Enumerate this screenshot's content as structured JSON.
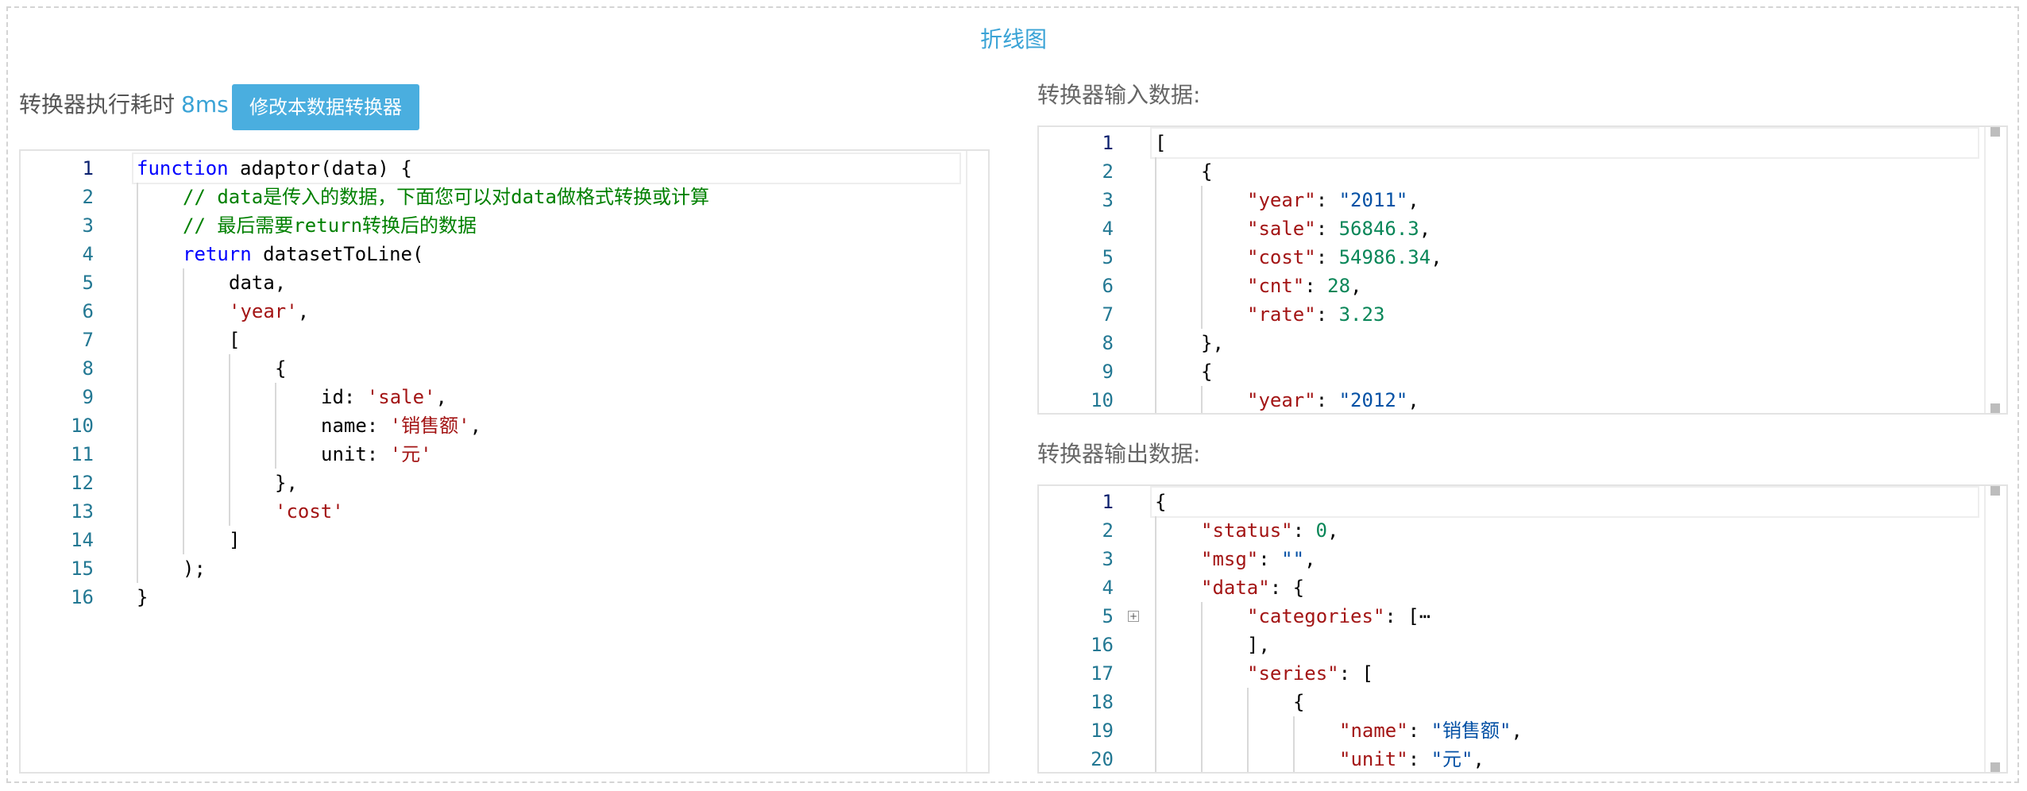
{
  "page": {
    "title": "折线图"
  },
  "perf": {
    "label": "转换器执行耗时",
    "value": "8ms"
  },
  "toolbar": {
    "edit_label": "修改本数据转换器"
  },
  "input_label": "转换器输入数据:",
  "output_label": "转换器输出数据:",
  "colors": {
    "accent": "#3aa3d6",
    "button": "#4aaedf",
    "keyword": "#0000ff",
    "comment": "#008000",
    "string": "#a31515",
    "json_value": "#0451a5",
    "json_number": "#098658",
    "line_number": "#237893"
  },
  "adaptor_code": [
    {
      "n": "1",
      "indent": 0,
      "tokens": [
        {
          "t": "function",
          "c": "kw"
        },
        {
          "t": " adaptor(data) {"
        }
      ]
    },
    {
      "n": "2",
      "indent": 1,
      "tokens": [
        {
          "t": "// data是传入的数据，下面您可以对data做格式转换或计算",
          "c": "cm"
        }
      ]
    },
    {
      "n": "3",
      "indent": 1,
      "tokens": [
        {
          "t": "// 最后需要return转换后的数据",
          "c": "cm"
        }
      ]
    },
    {
      "n": "4",
      "indent": 1,
      "tokens": [
        {
          "t": "return",
          "c": "kw"
        },
        {
          "t": " datasetToLine("
        }
      ]
    },
    {
      "n": "5",
      "indent": 2,
      "tokens": [
        {
          "t": "data,"
        }
      ]
    },
    {
      "n": "6",
      "indent": 2,
      "tokens": [
        {
          "t": "'year'",
          "c": "st"
        },
        {
          "t": ","
        }
      ]
    },
    {
      "n": "7",
      "indent": 2,
      "tokens": [
        {
          "t": "["
        }
      ]
    },
    {
      "n": "8",
      "indent": 3,
      "tokens": [
        {
          "t": "{"
        }
      ]
    },
    {
      "n": "9",
      "indent": 4,
      "tokens": [
        {
          "t": "id: "
        },
        {
          "t": "'sale'",
          "c": "st"
        },
        {
          "t": ","
        }
      ]
    },
    {
      "n": "10",
      "indent": 4,
      "tokens": [
        {
          "t": "name: "
        },
        {
          "t": "'销售额'",
          "c": "st"
        },
        {
          "t": ","
        }
      ]
    },
    {
      "n": "11",
      "indent": 4,
      "tokens": [
        {
          "t": "unit: "
        },
        {
          "t": "'元'",
          "c": "st"
        }
      ]
    },
    {
      "n": "12",
      "indent": 3,
      "tokens": [
        {
          "t": "},"
        }
      ]
    },
    {
      "n": "13",
      "indent": 3,
      "tokens": [
        {
          "t": "'cost'",
          "c": "st"
        }
      ]
    },
    {
      "n": "14",
      "indent": 2,
      "tokens": [
        {
          "t": "]"
        }
      ]
    },
    {
      "n": "15",
      "indent": 1,
      "tokens": [
        {
          "t": ");"
        }
      ]
    },
    {
      "n": "16",
      "indent": 0,
      "tokens": [
        {
          "t": "}"
        }
      ]
    }
  ],
  "input_json": [
    {
      "n": "1",
      "indent": 0,
      "tokens": [
        {
          "t": "["
        }
      ]
    },
    {
      "n": "2",
      "indent": 1,
      "tokens": [
        {
          "t": "{"
        }
      ]
    },
    {
      "n": "3",
      "indent": 2,
      "tokens": [
        {
          "t": "\"year\"",
          "c": "jk"
        },
        {
          "t": ": "
        },
        {
          "t": "\"2011\"",
          "c": "jv"
        },
        {
          "t": ","
        }
      ]
    },
    {
      "n": "4",
      "indent": 2,
      "tokens": [
        {
          "t": "\"sale\"",
          "c": "jk"
        },
        {
          "t": ": "
        },
        {
          "t": "56846.3",
          "c": "jn"
        },
        {
          "t": ","
        }
      ]
    },
    {
      "n": "5",
      "indent": 2,
      "tokens": [
        {
          "t": "\"cost\"",
          "c": "jk"
        },
        {
          "t": ": "
        },
        {
          "t": "54986.34",
          "c": "jn"
        },
        {
          "t": ","
        }
      ]
    },
    {
      "n": "6",
      "indent": 2,
      "tokens": [
        {
          "t": "\"cnt\"",
          "c": "jk"
        },
        {
          "t": ": "
        },
        {
          "t": "28",
          "c": "jn"
        },
        {
          "t": ","
        }
      ]
    },
    {
      "n": "7",
      "indent": 2,
      "tokens": [
        {
          "t": "\"rate\"",
          "c": "jk"
        },
        {
          "t": ": "
        },
        {
          "t": "3.23",
          "c": "jn"
        }
      ]
    },
    {
      "n": "8",
      "indent": 1,
      "tokens": [
        {
          "t": "},"
        }
      ]
    },
    {
      "n": "9",
      "indent": 1,
      "tokens": [
        {
          "t": "{"
        }
      ]
    },
    {
      "n": "10",
      "indent": 2,
      "tokens": [
        {
          "t": "\"year\"",
          "c": "jk"
        },
        {
          "t": ": "
        },
        {
          "t": "\"2012\"",
          "c": "jv"
        },
        {
          "t": ","
        }
      ]
    }
  ],
  "output_json": [
    {
      "n": "1",
      "indent": 0,
      "tokens": [
        {
          "t": "{"
        }
      ]
    },
    {
      "n": "2",
      "indent": 1,
      "tokens": [
        {
          "t": "\"status\"",
          "c": "jk"
        },
        {
          "t": ": "
        },
        {
          "t": "0",
          "c": "jn"
        },
        {
          "t": ","
        }
      ]
    },
    {
      "n": "3",
      "indent": 1,
      "tokens": [
        {
          "t": "\"msg\"",
          "c": "jk"
        },
        {
          "t": ": "
        },
        {
          "t": "\"\"",
          "c": "jv"
        },
        {
          "t": ","
        }
      ]
    },
    {
      "n": "4",
      "indent": 1,
      "tokens": [
        {
          "t": "\"data\"",
          "c": "jk"
        },
        {
          "t": ": {"
        }
      ]
    },
    {
      "n": "5",
      "indent": 2,
      "fold": true,
      "tokens": [
        {
          "t": "\"categories\"",
          "c": "jk"
        },
        {
          "t": ": [⋯"
        }
      ]
    },
    {
      "n": "16",
      "indent": 2,
      "tokens": [
        {
          "t": "],"
        }
      ]
    },
    {
      "n": "17",
      "indent": 2,
      "tokens": [
        {
          "t": "\"series\"",
          "c": "jk"
        },
        {
          "t": ": ["
        }
      ]
    },
    {
      "n": "18",
      "indent": 3,
      "tokens": [
        {
          "t": "{"
        }
      ]
    },
    {
      "n": "19",
      "indent": 4,
      "tokens": [
        {
          "t": "\"name\"",
          "c": "jk"
        },
        {
          "t": ": "
        },
        {
          "t": "\"销售额\"",
          "c": "jv"
        },
        {
          "t": ","
        }
      ]
    },
    {
      "n": "20",
      "indent": 4,
      "tokens": [
        {
          "t": "\"unit\"",
          "c": "jk"
        },
        {
          "t": ": "
        },
        {
          "t": "\"元\"",
          "c": "jv"
        },
        {
          "t": ","
        }
      ]
    }
  ]
}
